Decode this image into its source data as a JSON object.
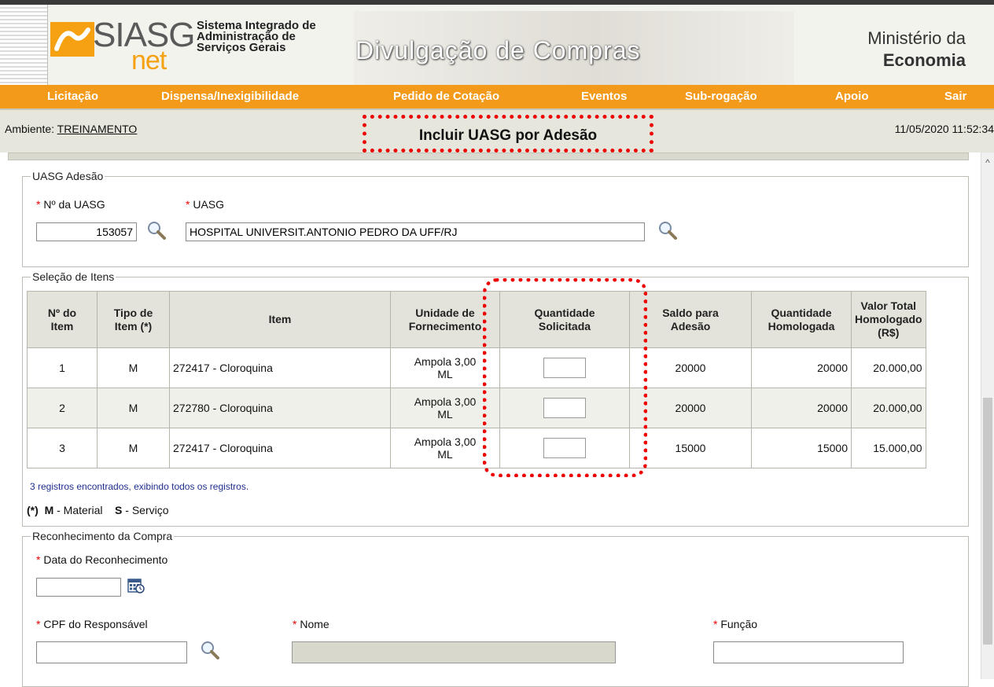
{
  "header": {
    "logo_siasg": "SIASG",
    "logo_net": "net",
    "system_line1": "Sistema Integrado de",
    "system_line2": "Administração de",
    "system_line3": "Serviços Gerais",
    "banner_title": "Divulgação de Compras",
    "ministry_line1": "Ministério da",
    "ministry_line2": "Economia"
  },
  "menu": {
    "items": [
      "Licitação",
      "Dispensa/Inexigibilidade",
      "Pedido de Cotação",
      "Eventos",
      "Sub-rogação",
      "Apoio",
      "Sair"
    ]
  },
  "env": {
    "label": "Ambiente: ",
    "value": "TREINAMENTO",
    "page_title": "Incluir UASG por Adesão",
    "datetime": "11/05/2020 11:52:34"
  },
  "uasg": {
    "legend": "UASG Adesão",
    "num_label": "Nº da UASG",
    "num_value": "153057",
    "name_label": "UASG",
    "name_value": "HOSPITAL UNIVERSIT.ANTONIO PEDRO DA UFF/RJ"
  },
  "items": {
    "legend": "Seleção de Itens",
    "headers": {
      "num_l1": "Nº do",
      "num_l2": "Item",
      "tipo_l1": "Tipo de",
      "tipo_l2": "Item (*)",
      "item": "Item",
      "unid_l1": "Unidade de",
      "unid_l2": "Fornecimento",
      "qtd_l1": "Quantidade",
      "qtd_l2": "Solicitada",
      "saldo_l1": "Saldo para",
      "saldo_l2": "Adesão",
      "qhom_l1": "Quantidade",
      "qhom_l2": "Homologada",
      "val_l1": "Valor Total",
      "val_l2": "Homologado",
      "val_l3": "(R$)"
    },
    "rows": [
      {
        "num": "1",
        "tipo": "M",
        "item": "272417 - Cloroquina",
        "unid_l1": "Ampola 3,00",
        "unid_l2": "ML",
        "saldo": "20000",
        "qhom": "20000",
        "valor": "20.000,00"
      },
      {
        "num": "2",
        "tipo": "M",
        "item": "272780 - Cloroquina",
        "unid_l1": "Ampola 3,00",
        "unid_l2": "ML",
        "saldo": "20000",
        "qhom": "20000",
        "valor": "20.000,00"
      },
      {
        "num": "3",
        "tipo": "M",
        "item": "272417 - Cloroquina",
        "unid_l1": "Ampola 3,00",
        "unid_l2": "ML",
        "saldo": "15000",
        "qhom": "15000",
        "valor": "15.000,00"
      }
    ],
    "records_text": "3 registros encontrados, exibindo todos os registros.",
    "legend_prefix": "(*)",
    "legend_m": "M",
    "legend_m_text": " - Material",
    "legend_s": "S",
    "legend_s_text": " - Serviço"
  },
  "reconhecimento": {
    "legend": "Reconhecimento da Compra",
    "data_label": "Data do Reconhecimento",
    "cpf_label": "CPF do Responsável",
    "nome_label": "Nome",
    "funcao_label": "Função"
  },
  "colors": {
    "menu_bg": "#f49a1a",
    "highlight": "#e00000",
    "env_bg": "#e6e6dc"
  }
}
